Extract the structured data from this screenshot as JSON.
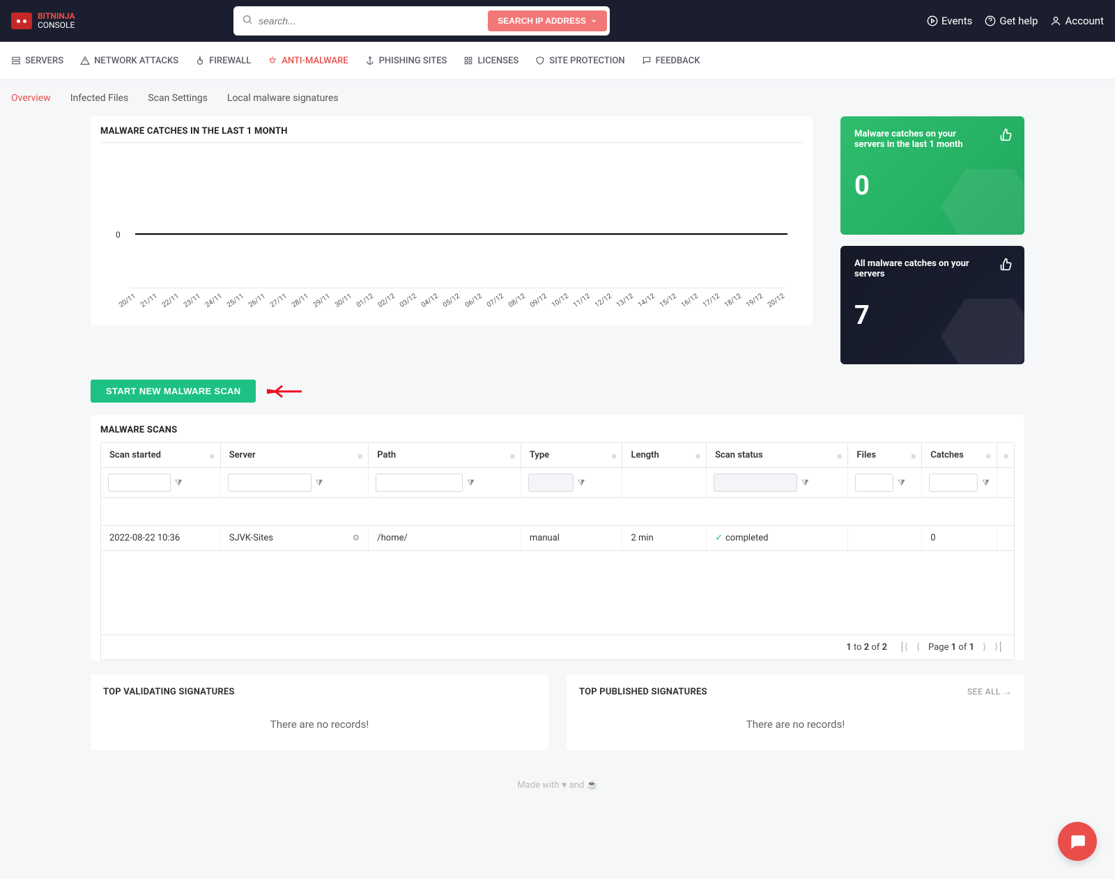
{
  "logo": {
    "brand": "BITNINJA",
    "console": "CONSOLE"
  },
  "search": {
    "placeholder": "search...",
    "btn": "SEARCH IP ADDRESS"
  },
  "header_links": [
    "Events",
    "Get help",
    "Account"
  ],
  "main_nav": [
    "SERVERS",
    "NETWORK ATTACKS",
    "FIREWALL",
    "ANTI-MALWARE",
    "PHISHING SITES",
    "LICENSES",
    "SITE PROTECTION",
    "FEEDBACK"
  ],
  "main_nav_active": 3,
  "sub_nav": [
    "Overview",
    "Infected Files",
    "Scan Settings",
    "Local malware signatures"
  ],
  "sub_nav_active": 0,
  "chart_card_title": "MALWARE CATCHES IN THE LAST 1 MONTH",
  "chart_data": {
    "type": "line",
    "title": "MALWARE CATCHES IN THE LAST 1 MONTH",
    "xlabel": "",
    "ylabel": "",
    "ylim": [
      0,
      1
    ],
    "categories": [
      "20/11",
      "21/11",
      "22/11",
      "23/11",
      "24/11",
      "25/11",
      "26/11",
      "27/11",
      "28/11",
      "29/11",
      "30/11",
      "01/12",
      "02/12",
      "03/12",
      "04/12",
      "05/12",
      "06/12",
      "07/12",
      "08/12",
      "09/12",
      "10/12",
      "11/12",
      "12/12",
      "13/12",
      "14/12",
      "15/12",
      "16/12",
      "17/12",
      "18/12",
      "19/12",
      "20/12"
    ],
    "series": [
      {
        "name": "catches",
        "values": [
          0,
          0,
          0,
          0,
          0,
          0,
          0,
          0,
          0,
          0,
          0,
          0,
          0,
          0,
          0,
          0,
          0,
          0,
          0,
          0,
          0,
          0,
          0,
          0,
          0,
          0,
          0,
          0,
          0,
          0,
          0
        ]
      }
    ],
    "y_tick_labels": [
      "0"
    ]
  },
  "stat_cards": [
    {
      "title": "Malware catches on your servers in the last 1 month",
      "value": "0"
    },
    {
      "title": "All malware catches on your servers",
      "value": "7"
    }
  ],
  "start_scan_btn": "START NEW MALWARE SCAN",
  "scans_card_title": "MALWARE SCANS",
  "table": {
    "headers": [
      "Scan started",
      "Server",
      "Path",
      "Type",
      "Length",
      "Scan status",
      "Files",
      "Catches",
      ""
    ],
    "row": {
      "scan_started": "2022-08-22 10:36",
      "server": "SJVK-Sites",
      "path": "/home/",
      "type": "manual",
      "length": "2 min",
      "status": "completed",
      "files": "",
      "catches": "0"
    },
    "pagination": {
      "summary_pre": "1",
      "summary_to": "to",
      "summary_mid": "2",
      "summary_of": "of",
      "summary_total": "2",
      "page_label_pre": "Page",
      "page_current": "1",
      "page_label_of": "of",
      "page_total": "1"
    }
  },
  "bottom": {
    "left_title": "TOP VALIDATING SIGNATURES",
    "right_title": "TOP PUBLISHED SIGNATURES",
    "see_all": "SEE ALL →",
    "no_records": "There are no records!"
  },
  "footer": "Made with ♥ and ☕"
}
